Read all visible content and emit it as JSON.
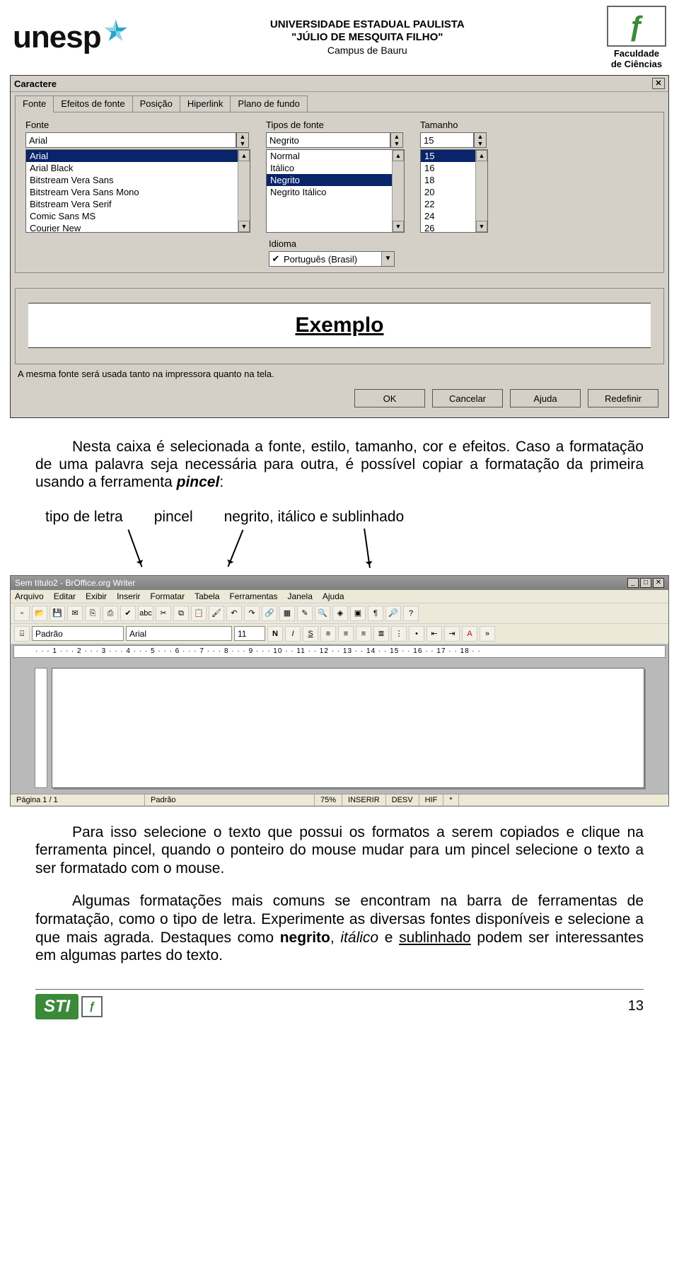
{
  "header": {
    "unesp": "unesp",
    "uni_line1": "UNIVERSIDADE ESTADUAL PAULISTA",
    "uni_line2": "\"JÚLIO DE MESQUITA FILHO\"",
    "campus": "Campus de Bauru",
    "fac_glyph": "ƒ",
    "fac_line1": "Faculdade",
    "fac_line2": "de Ciências"
  },
  "dialog": {
    "title": "Caractere",
    "tabs": [
      "Fonte",
      "Efeitos de fonte",
      "Posição",
      "Hiperlink",
      "Plano de fundo"
    ],
    "font_label": "Fonte",
    "font_value": "Arial",
    "font_list": [
      "Arial",
      "Arial Black",
      "Bitstream Vera Sans",
      "Bitstream Vera Sans Mono",
      "Bitstream Vera Serif",
      "Comic Sans MS",
      "Courier New"
    ],
    "style_label": "Tipos de fonte",
    "style_value": "Negrito",
    "style_list": [
      "Normal",
      "Itálico",
      "Negrito",
      "Negrito Itálico"
    ],
    "size_label": "Tamanho",
    "size_value": "15",
    "size_list": [
      "15",
      "16",
      "18",
      "20",
      "22",
      "24",
      "26"
    ],
    "lang_label": "Idioma",
    "lang_value": "Português (Brasil)",
    "preview": "Exemplo",
    "hint": "A mesma fonte será usada tanto na impressora quanto na tela.",
    "buttons": {
      "ok": "OK",
      "cancel": "Cancelar",
      "help": "Ajuda",
      "reset": "Redefinir"
    }
  },
  "text1": {
    "p1": "Nesta caixa é selecionada a fonte, estilo, tamanho, cor e efeitos. Caso a formatação de uma palavra seja necessária para outra, é possível copiar a formatação da primeira usando a ferramenta ",
    "pincel": "pincel",
    "colon": ":"
  },
  "labels": {
    "l1": "tipo de letra",
    "l2": "pincel",
    "l3": "negrito, itálico e sublinhado"
  },
  "writer": {
    "title": "Sem título2 - BrOffice.org Writer",
    "menu": [
      "Arquivo",
      "Editar",
      "Exibir",
      "Inserir",
      "Formatar",
      "Tabela",
      "Ferramentas",
      "Janela",
      "Ajuda"
    ],
    "style": "Padrão",
    "font": "Arial",
    "size": "11",
    "ruler": "· · · 1 · · · 2 · · · 3 · · · 4 · · · 5 · · · 6 · · · 7 · · · 8 · · · 9 · · · 10 · · 11 · · 12 · · 13 · · 14 · · 15 · · 16 · · 17 · · 18 · ·",
    "status": {
      "page": "Página 1 / 1",
      "style": "Padrão",
      "zoom": "75%",
      "ins": "INSERIR",
      "desv": "DESV",
      "hif": "HIF",
      "star": "*"
    }
  },
  "text2": {
    "p1a": "Para isso selecione o texto que possui os formatos a serem copiados e clique na ferramenta pincel, quando o ponteiro do mouse mudar para um pincel selecione o texto a ser formatado com o mouse.",
    "p2a": "Algumas formatações mais comuns se encontram na barra de ferramentas de formatação, como o tipo de letra. Experimente as diversas fontes disponíveis e selecione a que mais agrada. Destaques como ",
    "negrito": "negrito",
    "comma1": ", ",
    "italico": "itálico",
    "e": " e ",
    "sublinhado": "sublinhado",
    "p2b": " podem ser interessantes em algumas partes do texto."
  },
  "footer": {
    "sti": "STI",
    "sq": "ƒ",
    "page": "13"
  }
}
